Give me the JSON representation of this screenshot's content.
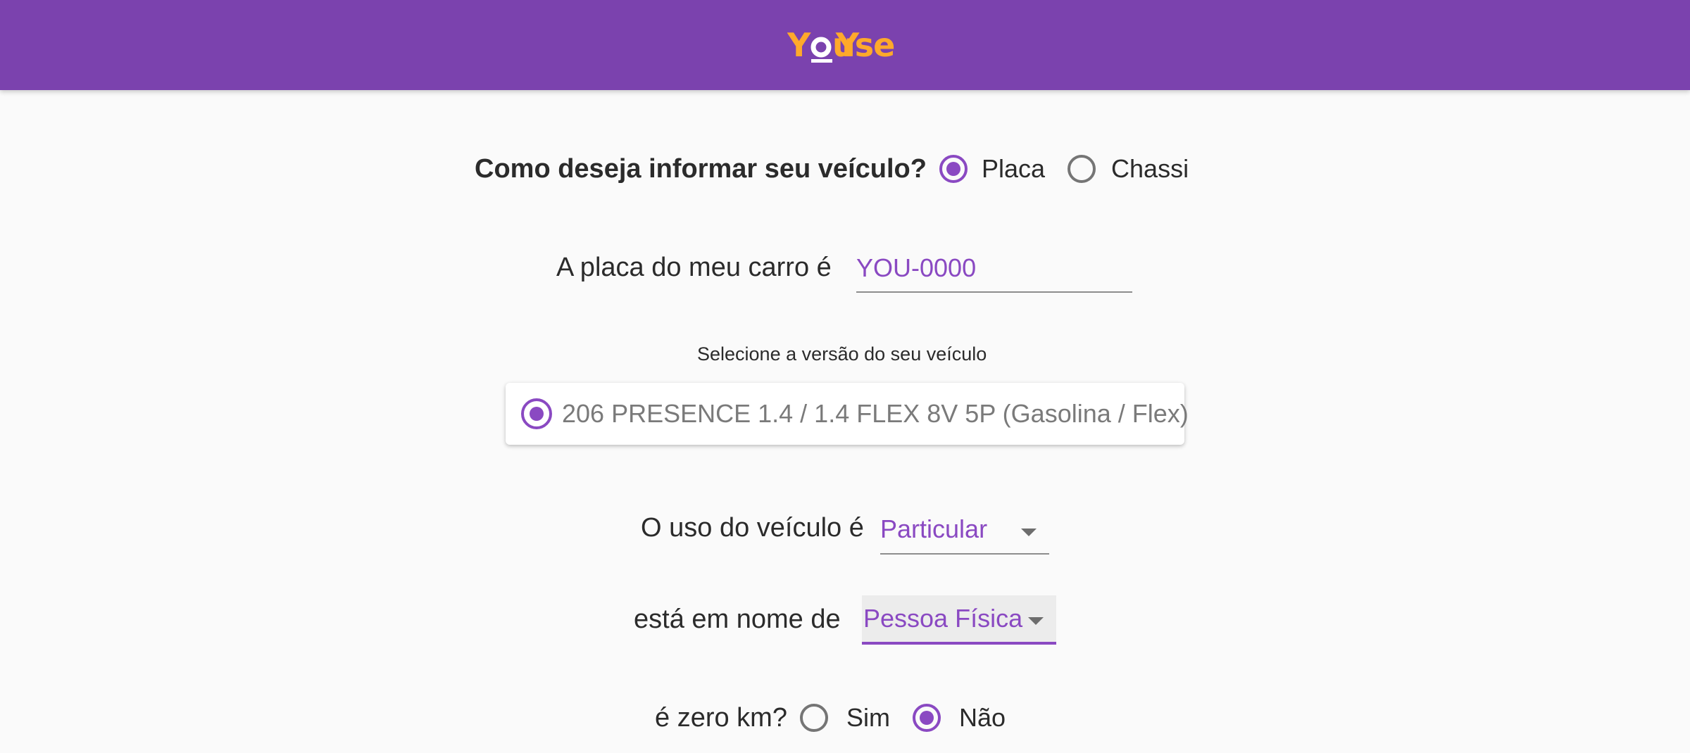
{
  "header": {
    "logo_text": "YOUSE",
    "logo_color": "#ffa92b",
    "bar_color": "#7b42ae"
  },
  "vehicle_info": {
    "question": "Como deseja informar seu veículo?",
    "options": [
      {
        "label": "Placa",
        "selected": true
      },
      {
        "label": "Chassi",
        "selected": false
      }
    ]
  },
  "plate": {
    "label": "A placa do meu carro é",
    "value": "YOU-0000"
  },
  "version": {
    "hint": "Selecione a versão do seu veículo",
    "option": "206 PRESENCE 1.4 / 1.4 FLEX 8V 5P (Gasolina / Flex)",
    "selected": true
  },
  "usage": {
    "label": "O uso do veículo é",
    "value": "Particular"
  },
  "owner": {
    "label": "está em nome de",
    "value": "Pessoa Física"
  },
  "zero_km": {
    "label": "é zero km?",
    "options": [
      {
        "label": "Sim",
        "selected": false
      },
      {
        "label": "Não",
        "selected": true
      }
    ]
  },
  "colors": {
    "accent": "#8a49c2",
    "text": "#2b2b2b"
  }
}
